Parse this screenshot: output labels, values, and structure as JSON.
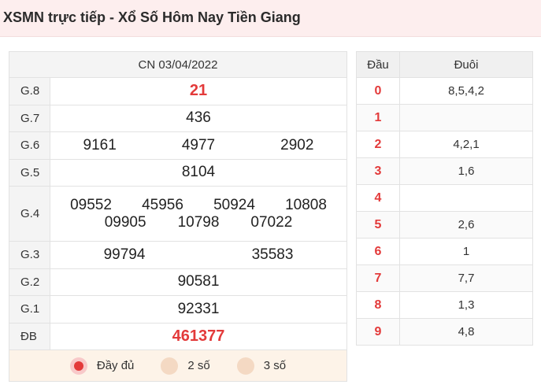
{
  "header": {
    "title": "XSMN trực tiếp - Xổ Số Hôm Nay Tiền Giang"
  },
  "results": {
    "date": "CN 03/04/2022",
    "g8": {
      "label": "G.8",
      "values": [
        "21"
      ]
    },
    "g7": {
      "label": "G.7",
      "values": [
        "436"
      ]
    },
    "g6": {
      "label": "G.6",
      "values": [
        "9161",
        "4977",
        "2902"
      ]
    },
    "g5": {
      "label": "G.5",
      "values": [
        "8104"
      ]
    },
    "g4": {
      "label": "G.4",
      "values": [
        "09552",
        "45956",
        "50924",
        "10808",
        "09905",
        "10798",
        "07022"
      ]
    },
    "g3": {
      "label": "G.3",
      "values": [
        "99794",
        "35583"
      ]
    },
    "g2": {
      "label": "G.2",
      "values": [
        "90581"
      ]
    },
    "g1": {
      "label": "G.1",
      "values": [
        "92331"
      ]
    },
    "db": {
      "label": "ĐB",
      "values": [
        "461377"
      ]
    }
  },
  "options": [
    {
      "label": "Đầy đủ",
      "selected": true
    },
    {
      "label": "2 số",
      "selected": false
    },
    {
      "label": "3 số",
      "selected": false
    }
  ],
  "loto": {
    "head_label": "Đầu",
    "tail_label": "Đuôi",
    "rows": [
      {
        "head": "0",
        "tail": "8,5,4,2"
      },
      {
        "head": "1",
        "tail": ""
      },
      {
        "head": "2",
        "tail": "4,2,1"
      },
      {
        "head": "3",
        "tail": "1,6"
      },
      {
        "head": "4",
        "tail": ""
      },
      {
        "head": "5",
        "tail": "2,6"
      },
      {
        "head": "6",
        "tail": "1"
      },
      {
        "head": "7",
        "tail": "7,7"
      },
      {
        "head": "8",
        "tail": "1,3"
      },
      {
        "head": "9",
        "tail": "4,8"
      }
    ]
  },
  "colors": {
    "accent": "#e33a3a",
    "header_bg": "#fdeeee",
    "options_bg": "#fdf3e8"
  }
}
